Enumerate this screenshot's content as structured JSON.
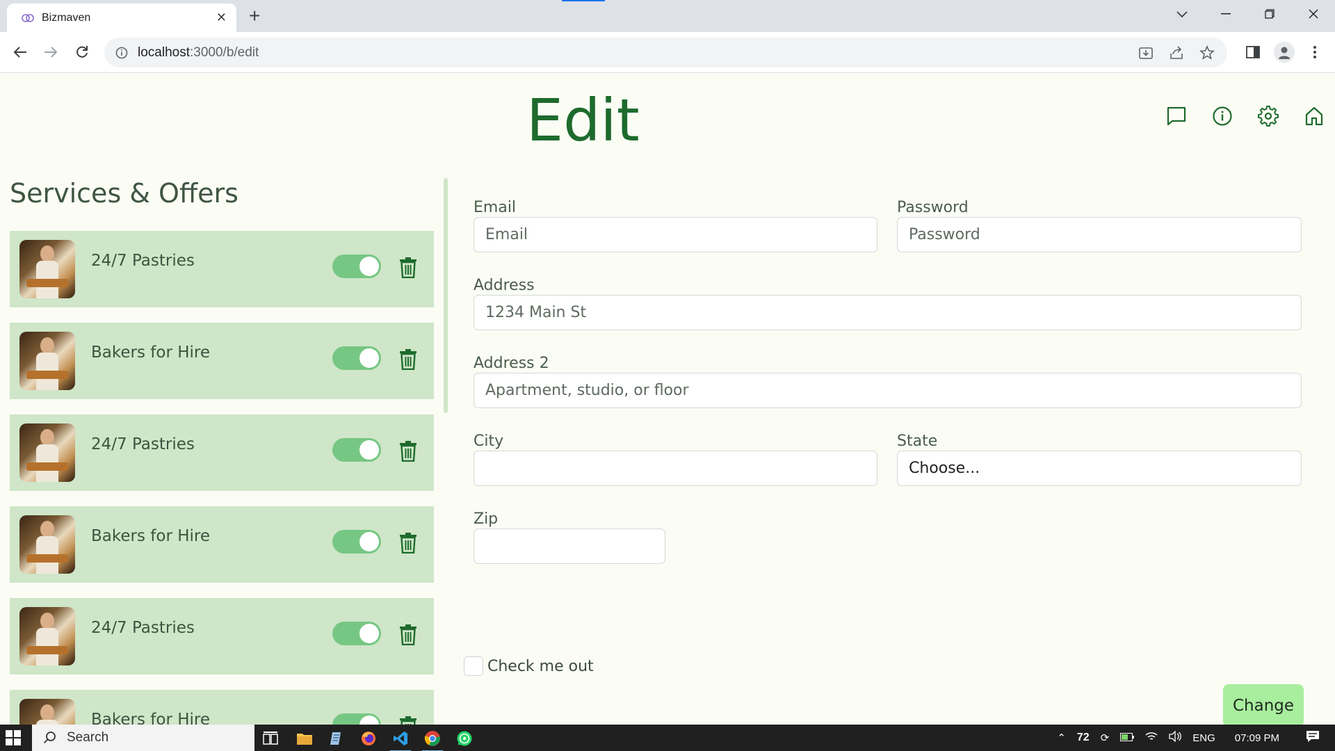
{
  "browser": {
    "tab_title": "Bizmaven",
    "url_host": "localhost",
    "url_path": ":3000/b/edit"
  },
  "app": {
    "page_title": "Edit",
    "section_title": "Services & Offers",
    "top_icons": [
      "chat-icon",
      "info-icon",
      "settings-icon",
      "home-icon"
    ],
    "accent_color": "#1e6b2d",
    "card_color": "#cfe6c8",
    "toggle_color": "#76c783",
    "button_color": "#a8ee9e",
    "services": [
      {
        "label": "24/7 Pastries",
        "enabled": true
      },
      {
        "label": "Bakers for Hire",
        "enabled": true
      },
      {
        "label": "24/7 Pastries",
        "enabled": true
      },
      {
        "label": "Bakers for Hire",
        "enabled": true
      },
      {
        "label": "24/7 Pastries",
        "enabled": true
      },
      {
        "label": "Bakers for Hire",
        "enabled": true
      }
    ]
  },
  "form": {
    "email_label": "Email",
    "email_placeholder": "Email",
    "password_label": "Password",
    "password_placeholder": "Password",
    "address_label": "Address",
    "address_placeholder": "1234 Main St",
    "address2_label": "Address 2",
    "address2_placeholder": "Apartment, studio, or floor",
    "city_label": "City",
    "city_value": "",
    "state_label": "State",
    "state_selected": "Choose...",
    "zip_label": "Zip",
    "zip_value": "",
    "check_label": "Check me out",
    "submit_label": "Change"
  },
  "taskbar": {
    "search_label": "Search",
    "temperature": "72",
    "language": "ENG",
    "time": "07:09 PM"
  }
}
